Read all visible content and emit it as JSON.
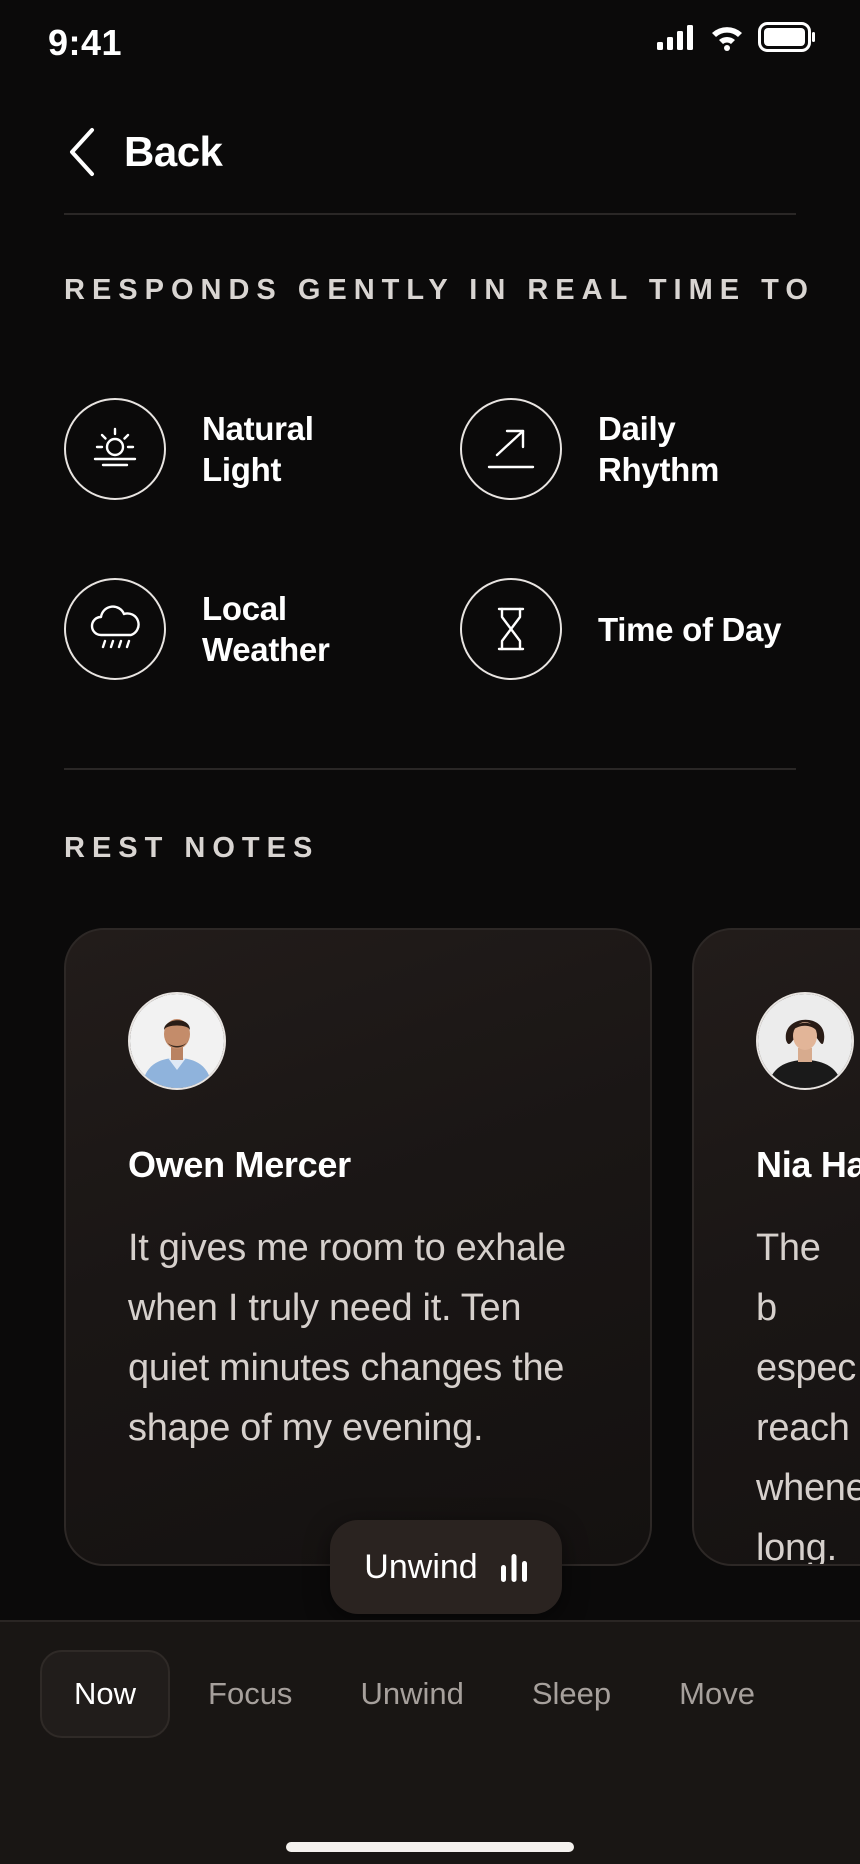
{
  "status_bar": {
    "time": "9:41"
  },
  "header": {
    "back_label": "Back"
  },
  "responds_section": {
    "title": "RESPONDS GENTLY IN REAL TIME TO",
    "items": [
      {
        "label": "Natural\nLight",
        "icon": "sunrise-icon"
      },
      {
        "label": "Daily\nRhythm",
        "icon": "trend-arrow-icon"
      },
      {
        "label": "Local\nWeather",
        "icon": "rain-cloud-icon"
      },
      {
        "label": "Time of Day",
        "icon": "hourglass-icon"
      }
    ]
  },
  "rest_notes": {
    "title": "REST NOTES",
    "cards": [
      {
        "name": "Owen Mercer",
        "quote": "It gives me room to exhale when I truly need it. Ten quiet minutes changes the shape of my evening."
      },
      {
        "name": "Nia Ha",
        "quote": "The b espec reach whene long."
      }
    ]
  },
  "floating_pill": {
    "label": "Unwind",
    "icon": "equalizer-icon"
  },
  "bottom_nav": {
    "tabs": [
      {
        "label": "Now",
        "active": true
      },
      {
        "label": "Focus",
        "active": false
      },
      {
        "label": "Unwind",
        "active": false
      },
      {
        "label": "Sleep",
        "active": false
      },
      {
        "label": "Move",
        "active": false
      }
    ]
  },
  "colors": {
    "background": "#0b0a0a",
    "card": "#1a1615",
    "nav": "#191614",
    "text": "#ffffff",
    "muted": "#a6a09c"
  }
}
